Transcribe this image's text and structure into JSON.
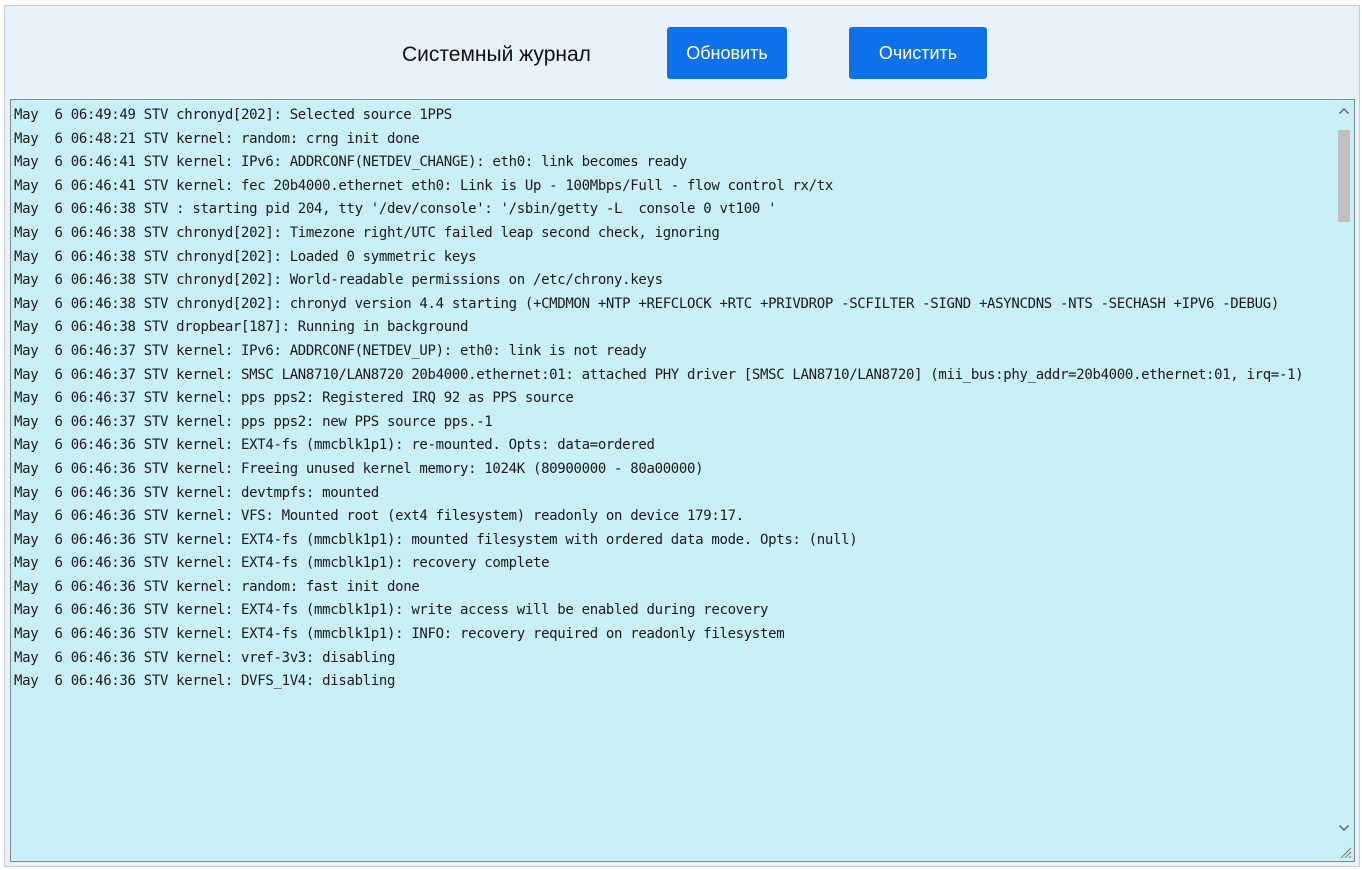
{
  "header": {
    "title": "Системный журнал",
    "refresh_label": "Обновить",
    "clear_label": "Очистить"
  },
  "colors": {
    "header_bg": "#e9f1fb",
    "button_bg": "#0d72ea",
    "log_bg": "#c9f0f7"
  },
  "icons": {
    "scroll_up": "chevron-up-icon",
    "scroll_down": "chevron-down-icon",
    "resize": "resize-grip-icon"
  },
  "log": {
    "lines": [
      "May  6 06:49:49 STV chronyd[202]: Selected source 1PPS",
      "May  6 06:48:21 STV kernel: random: crng init done",
      "May  6 06:46:41 STV kernel: IPv6: ADDRCONF(NETDEV_CHANGE): eth0: link becomes ready",
      "May  6 06:46:41 STV kernel: fec 20b4000.ethernet eth0: Link is Up - 100Mbps/Full - flow control rx/tx",
      "May  6 06:46:38 STV : starting pid 204, tty '/dev/console': '/sbin/getty -L  console 0 vt100 '",
      "May  6 06:46:38 STV chronyd[202]: Timezone right/UTC failed leap second check, ignoring",
      "May  6 06:46:38 STV chronyd[202]: Loaded 0 symmetric keys",
      "May  6 06:46:38 STV chronyd[202]: World-readable permissions on /etc/chrony.keys",
      "May  6 06:46:38 STV chronyd[202]: chronyd version 4.4 starting (+CMDMON +NTP +REFCLOCK +RTC +PRIVDROP -SCFILTER -SIGND +ASYNCDNS -NTS -SECHASH +IPV6 -DEBUG)",
      "May  6 06:46:38 STV dropbear[187]: Running in background",
      "May  6 06:46:37 STV kernel: IPv6: ADDRCONF(NETDEV_UP): eth0: link is not ready",
      "May  6 06:46:37 STV kernel: SMSC LAN8710/LAN8720 20b4000.ethernet:01: attached PHY driver [SMSC LAN8710/LAN8720] (mii_bus:phy_addr=20b4000.ethernet:01, irq=-1)",
      "May  6 06:46:37 STV kernel: pps pps2: Registered IRQ 92 as PPS source",
      "May  6 06:46:37 STV kernel: pps pps2: new PPS source pps.-1",
      "May  6 06:46:36 STV kernel: EXT4-fs (mmcblk1p1): re-mounted. Opts: data=ordered",
      "May  6 06:46:36 STV kernel: Freeing unused kernel memory: 1024K (80900000 - 80a00000)",
      "May  6 06:46:36 STV kernel: devtmpfs: mounted",
      "May  6 06:46:36 STV kernel: VFS: Mounted root (ext4 filesystem) readonly on device 179:17.",
      "May  6 06:46:36 STV kernel: EXT4-fs (mmcblk1p1): mounted filesystem with ordered data mode. Opts: (null)",
      "May  6 06:46:36 STV kernel: EXT4-fs (mmcblk1p1): recovery complete",
      "May  6 06:46:36 STV kernel: random: fast init done",
      "May  6 06:46:36 STV kernel: EXT4-fs (mmcblk1p1): write access will be enabled during recovery",
      "May  6 06:46:36 STV kernel: EXT4-fs (mmcblk1p1): INFO: recovery required on readonly filesystem",
      "May  6 06:46:36 STV kernel: vref-3v3: disabling",
      "May  6 06:46:36 STV kernel: DVFS_1V4: disabling"
    ]
  }
}
